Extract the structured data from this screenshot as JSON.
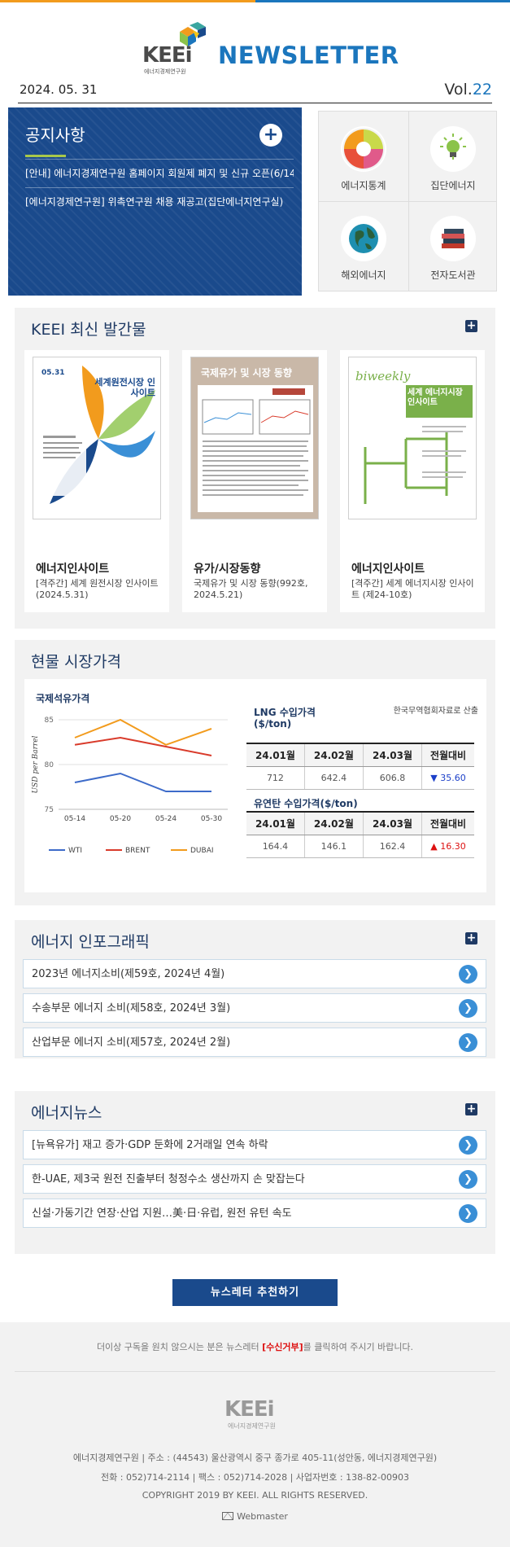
{
  "header": {
    "logo_text": "KEEi",
    "logo_sub": "에너지경제연구원",
    "brand": "NEWSLETTER",
    "date": "2024. 05. 31",
    "vol_prefix": "Vol.",
    "vol_number": "22"
  },
  "colors": {
    "navy": "#1a4a8c",
    "blue": "#1b76bd",
    "accent_green": "#a8c84a",
    "link_arrow": "#3a8fd6"
  },
  "notice": {
    "title": "공지사항",
    "plus_icon": "plus-circle-icon",
    "items": [
      "[안내] 에너지경제연구원 홈페이지 회원제 폐지 및 신규 오픈(6/14",
      "[에너지경제연구원] 위촉연구원 채용 재공고(집단에너지연구실)"
    ]
  },
  "quick_links": [
    {
      "label": "에너지통계",
      "icon": "pie-chart-icon"
    },
    {
      "label": "집단에너지",
      "icon": "lightbulb-icon"
    },
    {
      "label": "해외에너지",
      "icon": "globe-icon"
    },
    {
      "label": "전자도서관",
      "icon": "books-icon"
    }
  ],
  "publications": {
    "title": "KEEI 최신 발간물",
    "items": [
      {
        "name": "에너지인사이트",
        "desc": "[격주간] 세계 원전시장 인사이트(2024.5.31)",
        "cover_title": "세계원전시장 인사이트",
        "cover_date": "05.31"
      },
      {
        "name": "유가/시장동향",
        "desc": "국제유가 및 시장 동향(992호, 2024.5.21)",
        "cover_title": "국제유가 및 시장 동향"
      },
      {
        "name": "에너지인사이트",
        "desc": "[격주간] 세계 에너지시장 인사이트 (제24-10호)",
        "cover_title": "세계 에너지시장 인사이트",
        "cover_head": "biweekly"
      }
    ]
  },
  "market": {
    "title": "현물 시장가격",
    "lng": {
      "title": "LNG 수입가격 ($/ton)",
      "source": "한국무역협회자료로 산출",
      "headers": [
        "24.01월",
        "24.02월",
        "24.03월",
        "전월대비"
      ],
      "values": [
        "712",
        "642.4",
        "606.8"
      ],
      "change": "35.60",
      "change_dir": "down"
    },
    "coal": {
      "title": "유연탄 수입가격($/ton)",
      "headers": [
        "24.01월",
        "24.02월",
        "24.03월",
        "전월대비"
      ],
      "values": [
        "164.4",
        "146.1",
        "162.4"
      ],
      "change": "16.30",
      "change_dir": "up"
    }
  },
  "chart_data": {
    "type": "line",
    "title": "국제석유가격",
    "ylabel": "USD per Barrel",
    "xlabel": "",
    "categories": [
      "05-14",
      "05-20",
      "05-24",
      "05-30"
    ],
    "ylim": [
      75,
      85
    ],
    "yticks": [
      75,
      80,
      85
    ],
    "grid": true,
    "legend": "bottom",
    "series": [
      {
        "name": "WTI",
        "values": [
          78.0,
          79.0,
          77.0,
          77.0
        ],
        "color": "#3d6bc9"
      },
      {
        "name": "BRENT",
        "values": [
          82.2,
          83.0,
          82.0,
          81.0
        ],
        "color": "#d93b2b"
      },
      {
        "name": "DUBAI",
        "values": [
          83.0,
          85.0,
          82.2,
          84.0
        ],
        "color": "#f29b1d"
      }
    ]
  },
  "infographic": {
    "title": "에너지 인포그래픽",
    "items": [
      "2023년 에너지소비(제59호, 2024년 4월)",
      "수송부문 에너지 소비(제58호, 2024년 3월)",
      "산업부문 에너지 소비(제57호, 2024년 2월)"
    ]
  },
  "news": {
    "title": "에너지뉴스",
    "items": [
      "[뉴욕유가] 재고 증가·GDP 둔화에 2거래일 연속 하락",
      "한-UAE, 제3국 원전 진출부터 청정수소 생산까지 손 맞잡는다",
      "신설·가동기간 연장·산업 지원…美·日·유럽, 원전 유턴 속도"
    ]
  },
  "recommend_button": "뉴스레터 추천하기",
  "footer": {
    "unsub_before": "더이상 구독을 원치 않으시는 분은 뉴스레터 ",
    "unsub_link": "[수신거부]",
    "unsub_after": "를 클릭하여 주시기 바랍니다.",
    "logo_text": "KEEi",
    "logo_sub": "에너지경제연구원",
    "address": "에너지경제연구원 | 주소 : (44543) 울산광역시 중구 종가로 405-11(성안동, 에너지경제연구원)",
    "contact": "전화 : 052)714-2114 | 팩스 : 052)714-2028 | 사업자번호 : 138-82-00903",
    "copyright": "COPYRIGHT 2019 BY KEEI. ALL RIGHTS RESERVED.",
    "webmaster": "Webmaster"
  }
}
